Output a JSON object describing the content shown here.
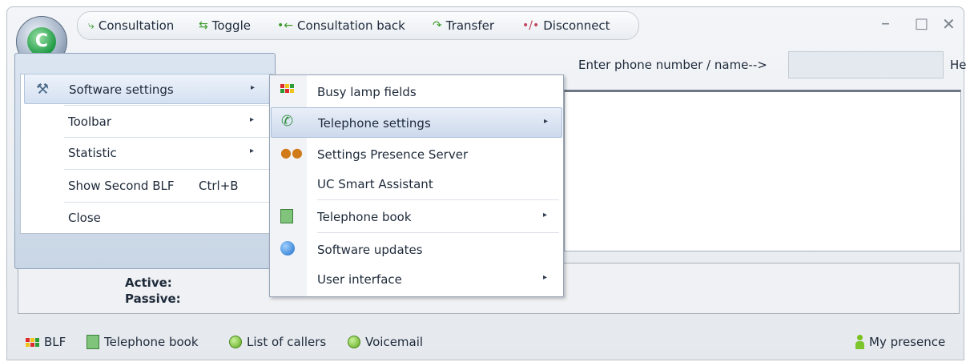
{
  "toolbar": {
    "items": [
      {
        "label": "Consultation",
        "icon": "consultation-icon",
        "glyph": "⤷"
      },
      {
        "label": "Toggle",
        "icon": "toggle-icon",
        "glyph": "⇆"
      },
      {
        "label": "Consultation back",
        "icon": "consultation-back-icon",
        "glyph": "•←"
      },
      {
        "label": "Transfer",
        "icon": "transfer-icon",
        "glyph": "↷"
      },
      {
        "label": "Disconnect",
        "icon": "disconnect-icon",
        "glyph": "•/•"
      }
    ],
    "minimize": "–",
    "maximize": "□",
    "close": "✕"
  },
  "app_logo_letter": "C",
  "search": {
    "label": "Enter phone number / name-->",
    "value": "",
    "help": "Help"
  },
  "status": {
    "active": "Active:",
    "passive": "Passive:"
  },
  "bottom": {
    "blf": "BLF",
    "telephone_book": "Telephone book",
    "list_of_callers": "List of callers",
    "voicemail": "Voicemail",
    "my_presence": "My presence"
  },
  "menu": {
    "items": [
      {
        "label": "Software settings",
        "arrow": "▸"
      },
      {
        "label": "Toolbar",
        "arrow": "▸"
      },
      {
        "label": "Statistic",
        "arrow": "▸"
      },
      {
        "label": "Show Second BLF",
        "shortcut": "Ctrl+B"
      },
      {
        "label": "Close"
      }
    ]
  },
  "submenu": {
    "items": [
      {
        "label": "Busy lamp fields",
        "icon": "busy-lamp-fields-icon"
      },
      {
        "label": "Telephone settings",
        "icon": "telephone-settings-icon",
        "arrow": "▸"
      },
      {
        "label": "Settings Presence Server",
        "icon": "presence-server-icon"
      },
      {
        "label": "UC Smart Assistant"
      },
      {
        "label": "Telephone book",
        "icon": "telephone-book-icon",
        "arrow": "▸"
      },
      {
        "label": "Software updates",
        "icon": "software-updates-icon"
      },
      {
        "label": "User interface",
        "arrow": "▸"
      }
    ]
  },
  "colors": {
    "highlight": "#d4e0f1",
    "accent_green": "#3c9a2a"
  }
}
